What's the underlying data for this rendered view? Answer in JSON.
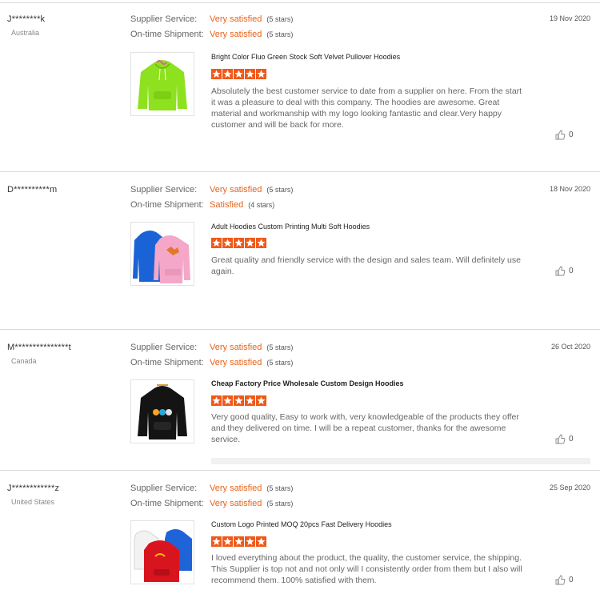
{
  "labels": {
    "supplier_service": "Supplier Service:",
    "ontime_shipment": "On-time Shipment:"
  },
  "colors": {
    "accent": "#e8631c",
    "star": "#f0591a"
  },
  "reviews": [
    {
      "user": "J********k",
      "country": "Australia",
      "date": "19 Nov 2020",
      "supplier_value": "Very satisfied",
      "supplier_stars": "(5 stars)",
      "shipment_value": "Very satisfied",
      "shipment_stars": "(5 stars)",
      "product": "Bright Color Fluo Green Stock Soft Velvet Pullover Hoodies",
      "rating": 5,
      "comment": "Absolutely the best customer service to date from a supplier on here. From the start it was a pleasure to deal with this company. The hoodies are awesome. Great material and workmanship with my logo looking fantastic and clear.Very happy customer and will be back for more.",
      "likes": "0",
      "image": "green-hoodie"
    },
    {
      "user": "D**********m",
      "country": "",
      "date": "18 Nov 2020",
      "supplier_value": "Very satisfied",
      "supplier_stars": "(5 stars)",
      "shipment_value": "Satisfied",
      "shipment_stars": "(4 stars)",
      "product": "Adult Hoodies Custom Printing Multi Soft Hoodies",
      "rating": 5,
      "comment": "Great quality and friendly service with the design and sales team. Will definitely use again.",
      "likes": "0",
      "image": "blue-pink-hoodies"
    },
    {
      "user": "M***************t",
      "country": "Canada",
      "date": "26 Oct 2020",
      "supplier_value": "Very satisfied",
      "supplier_stars": "(5 stars)",
      "shipment_value": "Very satisfied",
      "shipment_stars": "(5 stars)",
      "product": "Cheap Factory Price Wholesale Custom Design Hoodies",
      "rating": 5,
      "comment": "Very good quality, Easy to work with, very knowledgeable of the products they offer and they delivered on time.   I will be a repeat customer,  thanks for the awesome service.",
      "likes": "0",
      "image": "black-hoodie"
    },
    {
      "user": "J************z",
      "country": "United States",
      "date": "25 Sep 2020",
      "supplier_value": "Very satisfied",
      "supplier_stars": "(5 stars)",
      "shipment_value": "Very satisfied",
      "shipment_stars": "(5 stars)",
      "product": "Custom Logo Printed MOQ 20pcs Fast Delivery Hoodies",
      "rating": 5,
      "comment": "I loved everything about the product, the quality, the customer service, the shipping.  This Supplier is top not and not only will I consistently order from them but I also will recommend them. 100% satisfied with them.",
      "likes": "0",
      "image": "multi-color-hoodies"
    }
  ]
}
